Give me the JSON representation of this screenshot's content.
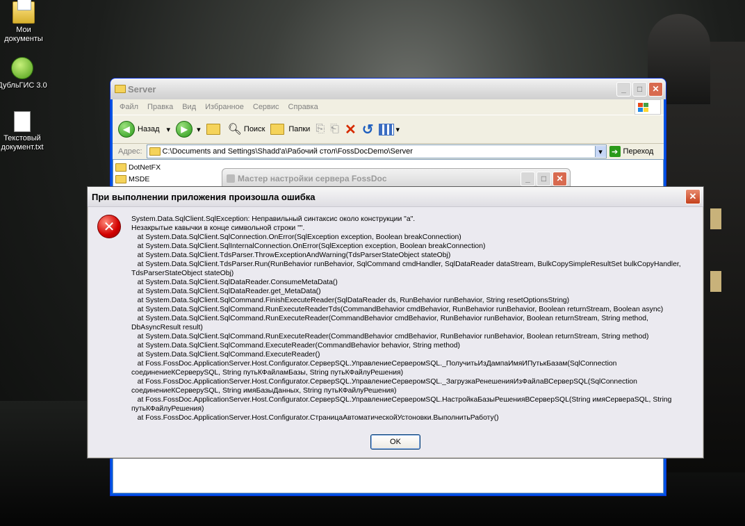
{
  "desktop": {
    "icons": [
      {
        "label": "Мои документы"
      },
      {
        "label": "ДубльГИС 3.0"
      },
      {
        "label": "Текстовый документ.txt"
      }
    ]
  },
  "explorer": {
    "title": "Server",
    "menu": [
      "Файл",
      "Правка",
      "Вид",
      "Избранное",
      "Сервис",
      "Справка"
    ],
    "toolbar": {
      "back": "Назад",
      "search": "Поиск",
      "folders": "Папки"
    },
    "address_label": "Адрес:",
    "address_value": "C:\\Documents and Settings\\Shadd'a\\Рабочий стол\\FossDocDemo\\Server",
    "go_label": "Переход",
    "folders": [
      "DotNetFX",
      "MSDE"
    ]
  },
  "wizard": {
    "title": "Мастер настройки сервера FossDoc"
  },
  "dialog": {
    "title": "При выполнении приложения произошла ошибка",
    "message": "System.Data.SqlClient.SqlException: Неправильный синтаксис около конструкции \"a\".\nНезакрытые кавычки в конце символьной строки \"\".\n   at System.Data.SqlClient.SqlConnection.OnError(SqlException exception, Boolean breakConnection)\n   at System.Data.SqlClient.SqlInternalConnection.OnError(SqlException exception, Boolean breakConnection)\n   at System.Data.SqlClient.TdsParser.ThrowExceptionAndWarning(TdsParserStateObject stateObj)\n   at System.Data.SqlClient.TdsParser.Run(RunBehavior runBehavior, SqlCommand cmdHandler, SqlDataReader dataStream, BulkCopySimpleResultSet bulkCopyHandler,\nTdsParserStateObject stateObj)\n   at System.Data.SqlClient.SqlDataReader.ConsumeMetaData()\n   at System.Data.SqlClient.SqlDataReader.get_MetaData()\n   at System.Data.SqlClient.SqlCommand.FinishExecuteReader(SqlDataReader ds, RunBehavior runBehavior, String resetOptionsString)\n   at System.Data.SqlClient.SqlCommand.RunExecuteReaderTds(CommandBehavior cmdBehavior, RunBehavior runBehavior, Boolean returnStream, Boolean async)\n   at System.Data.SqlClient.SqlCommand.RunExecuteReader(CommandBehavior cmdBehavior, RunBehavior runBehavior, Boolean returnStream, String method,\nDbAsyncResult result)\n   at System.Data.SqlClient.SqlCommand.RunExecuteReader(CommandBehavior cmdBehavior, RunBehavior runBehavior, Boolean returnStream, String method)\n   at System.Data.SqlClient.SqlCommand.ExecuteReader(CommandBehavior behavior, String method)\n   at System.Data.SqlClient.SqlCommand.ExecuteReader()\n   at Foss.FossDoc.ApplicationServer.Host.Configurator.СерверSQL.УправлениеСерверомSQL._ПолучитьИзДампаИмяИПутькБазам(SqlConnection\nсоединениеКСерверуSQL, String путьКФайламБазы, String путьКФайлуРешения)\n   at Foss.FossDoc.ApplicationServer.Host.Configurator.СерверSQL.УправлениеСерверомSQL._ЗагрузкаРенешенияИзФайлаВСерверSQL(SqlConnection\nсоединениеКСерверуSQL, String имяБазыДанных, String путьКФайлуРешения)\n   at Foss.FossDoc.ApplicationServer.Host.Configurator.СерверSQL.УправлениеСерверомSQL.НастройкаБазыРешенияВСерверSQL(String имяСервераSQL, String\nпутьКФайлуРешения)\n   at Foss.FossDoc.ApplicationServer.Host.Configurator.СтраницаАвтоматическойУстоновки.ВыполнитьРаботу()",
    "ok_label": "OK"
  }
}
